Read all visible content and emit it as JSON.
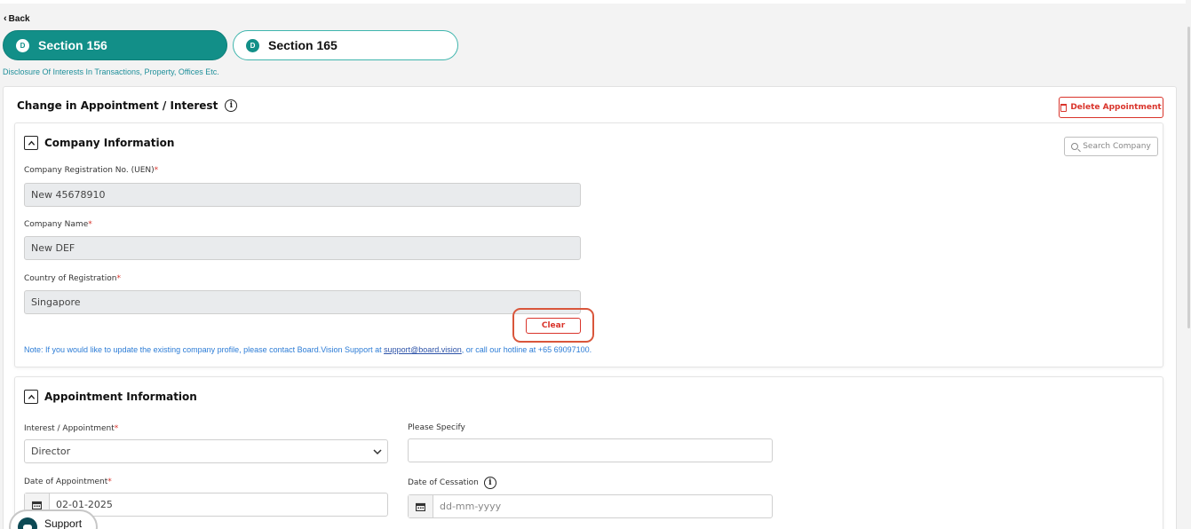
{
  "nav": {
    "back_label": "Back"
  },
  "tabs": [
    {
      "badge": "D",
      "label": "Section 156",
      "active": true
    },
    {
      "badge": "D",
      "label": "Section 165",
      "active": false
    }
  ],
  "subtitle": "Disclosure Of Interests In Transactions, Property, Offices Etc.",
  "main": {
    "title": "Change in Appointment / Interest",
    "delete_label": "Delete Appointment"
  },
  "company": {
    "header": "Company Information",
    "search_label": "Search Company",
    "fields": [
      {
        "label": "Company Registration No. (UEN)",
        "value": "New 45678910"
      },
      {
        "label": "Company Name",
        "value": "New DEF"
      },
      {
        "label": "Country of Registration",
        "value": "Singapore"
      }
    ],
    "required_mark": "*",
    "clear_label": "Clear",
    "note_prefix": "Note: If you would like to update the existing company profile, please contact Board.Vision Support at ",
    "note_email": "support@board.vision",
    "note_suffix": ", or call our hotline at +65 69097100."
  },
  "appointment": {
    "header": "Appointment Information",
    "interest_label": "Interest / Appointment",
    "interest_value": "Director",
    "specify_label": "Please Specify",
    "specify_value": "",
    "date_appt_label": "Date of Appointment",
    "date_appt_value": "02-01-2025",
    "date_cess_label": "Date of Cessation",
    "date_cess_placeholder": "dd-mm-yyyy"
  },
  "support": {
    "label": "Support"
  },
  "colors": {
    "teal": "#128f88",
    "danger": "#d9342b",
    "link": "#2c7cd6",
    "highlight": "#d9563b"
  }
}
